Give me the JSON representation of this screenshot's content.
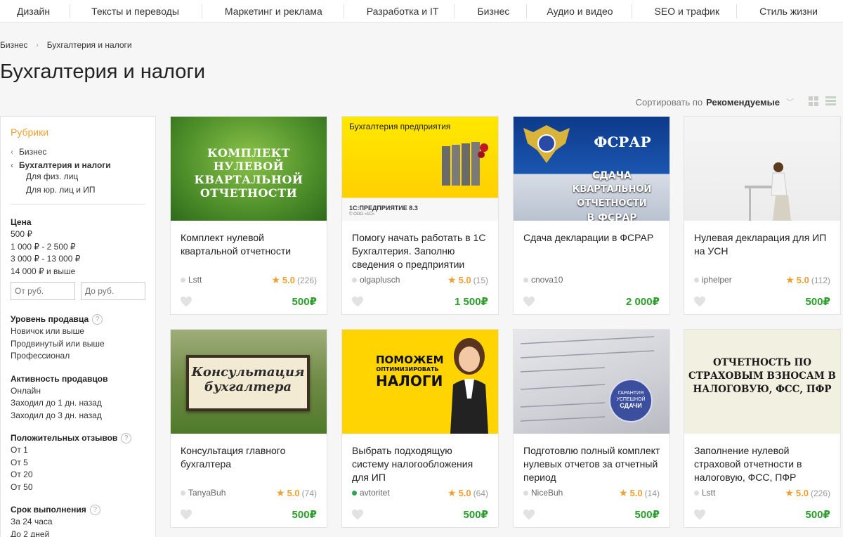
{
  "nav": {
    "items": [
      "Дизайн",
      "Тексты и переводы",
      "Маркетинг и реклама",
      "Разработка и IT",
      "Бизнес",
      "Аудио и видео",
      "SEO и трафик",
      "Стиль жизни"
    ]
  },
  "breadcrumb": {
    "root": "Бизнес",
    "current": "Бухгалтерия и налоги"
  },
  "page_title": "Бухгалтерия и налоги",
  "sort": {
    "label": "Сортировать по",
    "value": "Рекомендуемые"
  },
  "sidebar": {
    "rubrics_title": "Рубрики",
    "rubric_parent": "Бизнес",
    "rubric_current": "Бухгалтерия и налоги",
    "rubric_children": [
      "Для физ. лиц",
      "Для юр. лиц и ИП"
    ],
    "price": {
      "title": "Цена",
      "options": [
        "500 ₽",
        "1 000 ₽ - 2 500 ₽",
        "3 000 ₽ - 13 000 ₽",
        "14 000 ₽ и выше"
      ],
      "from_placeholder": "От руб.",
      "to_placeholder": "До руб."
    },
    "seller_level": {
      "title": "Уровень продавца",
      "options": [
        "Новичок или выше",
        "Продвинутый или выше",
        "Профессионал"
      ]
    },
    "seller_activity": {
      "title": "Активность продавцов",
      "options": [
        "Онлайн",
        "Заходил до 1 дн. назад",
        "Заходил до 3 дн. назад"
      ]
    },
    "positive_reviews": {
      "title": "Положительных отзывов",
      "options": [
        "От 1",
        "От 5",
        "От 20",
        "От 50"
      ]
    },
    "deadline": {
      "title": "Срок выполнения",
      "options": [
        "За 24 часа",
        "До 2 дней"
      ]
    }
  },
  "cards": [
    {
      "title": "Комплект нулевой квартальной отчетности",
      "seller": "Lstt",
      "online": false,
      "rating": "5.0",
      "reviews": "(226)",
      "price": "500₽",
      "image_text": [
        "КОМПЛЕКТ НУЛЕВОЙ",
        "КВАРТАЛЬНОЙ",
        "ОТЧЕТНОСТИ"
      ]
    },
    {
      "title": "Помогу начать работать в 1С Бухгалтерия. Заполню сведения о предприятии",
      "seller": "olgaplusch",
      "online": false,
      "rating": "5.0",
      "reviews": "(15)",
      "price": "1 500₽",
      "image_text": [
        "Бухгалтерия предприятия",
        "1С:ПРЕДПРИЯТИЕ 8.3",
        "© ООО «1С»"
      ]
    },
    {
      "title": "Сдача декларации в ФСРАР",
      "seller": "cnova10",
      "online": false,
      "rating": "",
      "reviews": "",
      "price": "2 000₽",
      "image_text": [
        "ФСРАР",
        "СДАЧА",
        "КВАРТАЛЬНОЙ ОТЧЕТНОСТИ",
        "В ФСРАР"
      ]
    },
    {
      "title": "Нулевая декларация для ИП на УСН",
      "seller": "iphelper",
      "online": false,
      "rating": "5.0",
      "reviews": "(112)",
      "price": "500₽",
      "image_text": []
    },
    {
      "title": "Консультация главного бухгалтера",
      "seller": "TanyaBuh",
      "online": false,
      "rating": "5.0",
      "reviews": "(74)",
      "price": "500₽",
      "image_text": [
        "Консультация",
        "бухгалтера"
      ]
    },
    {
      "title": "Выбрать подходящую систему налогообложения для ИП",
      "seller": "avtoritet",
      "online": true,
      "rating": "5.0",
      "reviews": "(64)",
      "price": "500₽",
      "image_text": [
        "ПОМОЖЕМ",
        "ОПТИМИЗИРОВАТЬ",
        "НАЛОГИ"
      ]
    },
    {
      "title": "Подготовлю полный комплект нулевых отчетов за отчетный период",
      "seller": "NiceBuh",
      "online": false,
      "rating": "5.0",
      "reviews": "(14)",
      "price": "500₽",
      "image_text": [
        "ГАРАНТИЯ",
        "УСПЕШНОЙ",
        "СДАЧИ"
      ]
    },
    {
      "title": "Заполнение нулевой страховой отчетности в налоговую, ФСС, ПФР",
      "seller": "Lstt",
      "online": false,
      "rating": "5.0",
      "reviews": "(226)",
      "price": "500₽",
      "image_text": [
        "ОТЧЕТНОСТЬ ПО",
        "СТРАХОВЫМ ВЗНОСАМ В",
        "НАЛОГОВУЮ, ФСС, ПФР"
      ]
    }
  ],
  "colors": {
    "accent_green": "#2a9d2a",
    "star_orange": "#f0a030",
    "rubrics_orange": "#f0a030"
  }
}
